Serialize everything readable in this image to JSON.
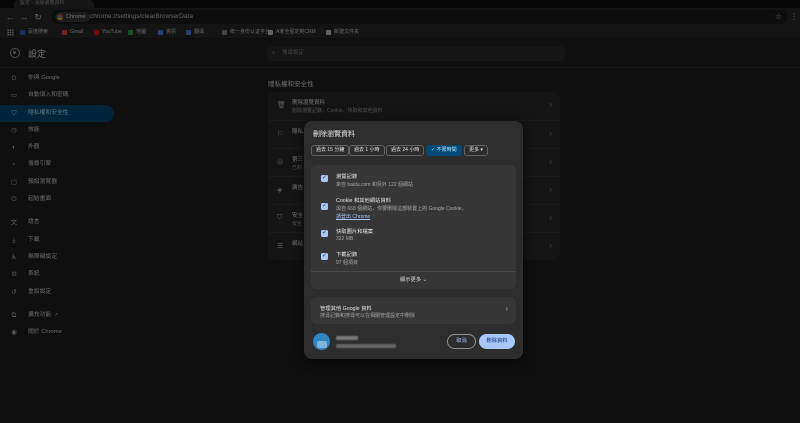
{
  "browser": {
    "tab_title": "設定 - 清除瀏覽資料",
    "chip_label": "Chrome",
    "url": "chrome://settings/clearBrowserData",
    "bookmarks": [
      {
        "label": "百度搜索",
        "color": "#2b5cd6"
      },
      {
        "label": "Gmail",
        "color": "#ea4335"
      },
      {
        "label": "YouTube",
        "color": "#ff0000"
      },
      {
        "label": "地圖",
        "color": "#34a853"
      },
      {
        "label": "資訊",
        "color": "#4285f4"
      },
      {
        "label": "翻译",
        "color": "#4285f4"
      },
      {
        "label": "统一身份认证平台",
        "color": "#888888"
      },
      {
        "label": "A家全屋定制CRM",
        "color": "#c4c4c4"
      },
      {
        "label": "新建文件夹",
        "color": "#c4c4c4"
      }
    ]
  },
  "settings": {
    "title": "設定",
    "search_placeholder": "搜尋設定",
    "nav": [
      {
        "label": "你與 Google",
        "icon": "G"
      },
      {
        "label": "自動填入和密碼",
        "icon": "▭"
      },
      {
        "label": "隱私權和安全性",
        "icon": "⛉"
      },
      {
        "label": "效能",
        "icon": "◷"
      },
      {
        "label": "外觀",
        "icon": "◐"
      },
      {
        "label": "搜尋引擎",
        "icon": "⌕"
      },
      {
        "label": "預設瀏覽器",
        "icon": "▢"
      },
      {
        "label": "起始畫面",
        "icon": "⏻"
      },
      {
        "label": "語言",
        "icon": "文"
      },
      {
        "label": "下載",
        "icon": "⤓"
      },
      {
        "label": "無障礙設定",
        "icon": "♿"
      },
      {
        "label": "系統",
        "icon": "⚙"
      },
      {
        "label": "重設設定",
        "icon": "↺"
      },
      {
        "label": "擴充功能",
        "icon": "⧉"
      },
      {
        "label": "關於 Chrome",
        "icon": "◉"
      }
    ],
    "section_title": "隱私權和安全性",
    "rows": [
      {
        "title": "刪除瀏覽資料",
        "sub": "刪除瀏覽記錄、Cookie、快取和其他資料",
        "icon": "🗑"
      },
      {
        "title": "隱私",
        "sub": "",
        "icon": "⚐"
      },
      {
        "title": "第三",
        "sub": "已封",
        "icon": "◎"
      },
      {
        "title": "廣告",
        "sub": "",
        "icon": "◈"
      },
      {
        "title": "安全",
        "sub": "安全",
        "icon": "⛉"
      },
      {
        "title": "網站",
        "sub": "",
        "icon": "☰"
      }
    ]
  },
  "dialog": {
    "title": "刪除瀏覽資料",
    "time_chips": [
      "過去 15 分鐘",
      "過去 1 小時",
      "過去 24 小時",
      "不限時間",
      "更多"
    ],
    "selected_chip": "不限時間",
    "items": [
      {
        "title": "瀏覽記錄",
        "sub": "來自 baidu.com 和另外 122 個網站",
        "checked": true
      },
      {
        "title": "Cookie 和其他網站資料",
        "sub": "與自 668 個網站，你要刪除這部裝置上的 Google Cookie。",
        "link": "請登出 Chrome",
        "checked": true
      },
      {
        "title": "快取圖片和檔案",
        "sub": "322 MB",
        "checked": true
      },
      {
        "title": "下載記錄",
        "sub": "97 個項目",
        "checked": true
      }
    ],
    "show_more": "顯示更多",
    "google_title": "管理其他 Google 資料",
    "google_sub": "搜尋記錄和搜尋可以在相關管理設定中刪除",
    "cancel": "取消",
    "confirm": "刪除資料"
  }
}
